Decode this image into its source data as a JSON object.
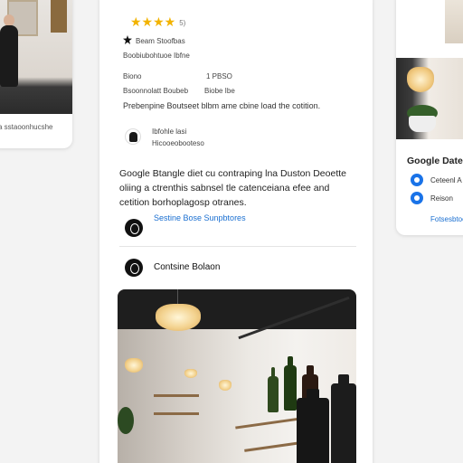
{
  "left_card": {
    "caption": "a sstaoonhucshe"
  },
  "main_card": {
    "rating_stars": "★★★★",
    "rating_count": "5)",
    "line_1": "Beam Stoofbas",
    "line_2": "Boobiubohtuoe Ibfne",
    "detail_a_label": "Biono",
    "detail_a_value": "1 PBSO",
    "detail_b_label": "Bsoonnolatt  Boubeb",
    "detail_b_value": "Biobe Ibe",
    "summary": "Prebenpine Boutseet  blbm ame cbine load the cotition.",
    "owner_line_1": "Ibfohle lasi",
    "owner_line_2": "Hicooeobooteso",
    "description": "Google Btangle diet cu contraping lna Duston Deoette oliing a ctrenthis sabnsel tle catenceiana efee and cetition borhoplagosp otranes.",
    "link_label": "Sestine Bose Sunpbtores",
    "section_title": "Contsine Bolaon"
  },
  "right_card": {
    "title": "Google Date",
    "item_1": "Ceteenl A",
    "item_2": "Reison",
    "link": "Fotsesbtoe"
  }
}
